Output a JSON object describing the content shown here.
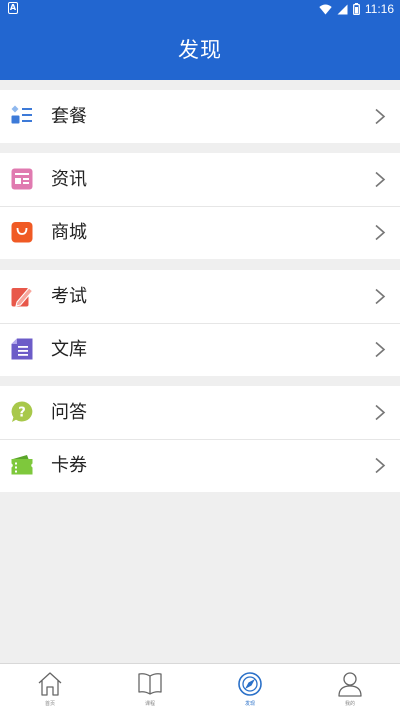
{
  "status_bar": {
    "notification_icon": "a-icon",
    "time": "11:16",
    "icons": [
      "wifi-icon",
      "signal-icon",
      "battery-icon"
    ]
  },
  "header": {
    "title": "发现"
  },
  "groups": [
    {
      "items": [
        {
          "label": "套餐",
          "icon": "package-list-icon",
          "color": "#3d7ad8"
        }
      ]
    },
    {
      "items": [
        {
          "label": "资讯",
          "icon": "news-icon",
          "color": "#e07ab0"
        },
        {
          "label": "商城",
          "icon": "shopping-bag-icon",
          "color": "#f05a24"
        }
      ]
    },
    {
      "items": [
        {
          "label": "考试",
          "icon": "exam-pencil-icon",
          "color": "#e8584a"
        },
        {
          "label": "文库",
          "icon": "document-library-icon",
          "color": "#6c5cc8"
        }
      ]
    },
    {
      "items": [
        {
          "label": "问答",
          "icon": "question-bubble-icon",
          "color": "#a8c84a"
        },
        {
          "label": "卡券",
          "icon": "coupon-ticket-icon",
          "color": "#7ec83c"
        }
      ]
    }
  ],
  "tab_bar": {
    "tabs": [
      {
        "label": "首页",
        "icon": "home-icon",
        "active": false
      },
      {
        "label": "课程",
        "icon": "book-icon",
        "active": false
      },
      {
        "label": "发现",
        "icon": "compass-icon",
        "active": true
      },
      {
        "label": "我的",
        "icon": "person-icon",
        "active": false
      }
    ],
    "active_color": "#2a70c8"
  },
  "colors": {
    "primary": "#2266d0",
    "background": "#efefef"
  }
}
